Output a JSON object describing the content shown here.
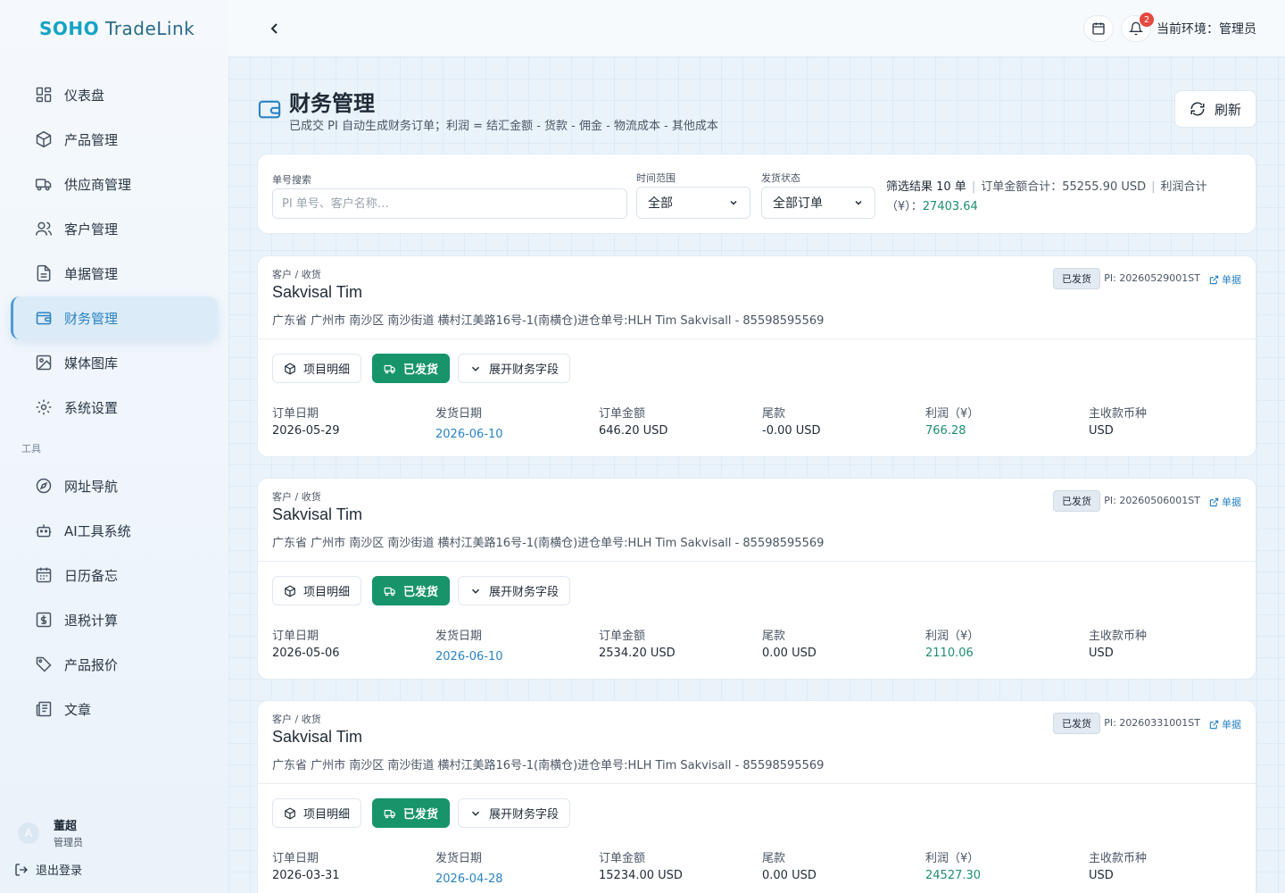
{
  "brand": {
    "part1": "SOHO",
    "part2": "TradeLink"
  },
  "nav": {
    "items": [
      {
        "label": "仪表盘",
        "icon": "dashboard-icon"
      },
      {
        "label": "产品管理",
        "icon": "package-icon"
      },
      {
        "label": "供应商管理",
        "icon": "truck-icon"
      },
      {
        "label": "客户管理",
        "icon": "users-icon"
      },
      {
        "label": "单据管理",
        "icon": "document-icon"
      },
      {
        "label": "财务管理",
        "icon": "wallet-icon",
        "active": true
      },
      {
        "label": "媒体图库",
        "icon": "image-icon"
      },
      {
        "label": "系统设置",
        "icon": "gear-icon"
      }
    ],
    "tools_section": "工具",
    "tools": [
      {
        "label": "网址导航",
        "icon": "compass-icon"
      },
      {
        "label": "AI工具系统",
        "icon": "robot-icon"
      },
      {
        "label": "日历备忘",
        "icon": "calendar-icon"
      },
      {
        "label": "退税计算",
        "icon": "dollar-icon"
      },
      {
        "label": "产品报价",
        "icon": "tag-icon"
      },
      {
        "label": "文章",
        "icon": "article-icon"
      }
    ]
  },
  "user": {
    "avatar": "A",
    "name": "董超",
    "role": "管理员",
    "logout": "退出登录"
  },
  "topbar": {
    "notifications": "2",
    "env": "当前环境：管理员"
  },
  "page": {
    "title": "财务管理",
    "subtitle": "已成交 PI 自动生成财务订单；利润 = 结汇金额 - 货款 - 佣金 - 物流成本 - 其他成本",
    "refresh": "刷新"
  },
  "filter": {
    "search_label": "单号搜索",
    "search_placeholder": "PI 单号、客户名称…",
    "time_label": "时间范围",
    "time_value": "全部",
    "status_label": "发货状态",
    "status_value": "全部订单",
    "result": "筛选结果 10 单",
    "total_amount": "订单金额合计：55255.90 USD",
    "profit_label": "利润合计（¥）：",
    "profit_value": "27403.64"
  },
  "labels": {
    "customer": "客户 / 收货",
    "details_btn": "项目明细",
    "shipped_btn": "已发货",
    "expand_btn": "展开财务字段",
    "doc_link": "单据",
    "order_date": "订单日期",
    "ship_date": "发货日期",
    "amount": "订单金额",
    "balance": "尾款",
    "profit": "利润（¥）",
    "currency": "主收款币种"
  },
  "orders": [
    {
      "name": "Sakvisal Tim",
      "address": "广东省 广州市 南沙区 南沙街道 横村江美路16号-1(南横仓)进仓单号:HLH Tim Sakvisall - 85598595569",
      "status": "已发货",
      "pi": "PI: 20260529001ST",
      "order_date": "2026-05-29",
      "ship_date": "2026-06-10",
      "amount": "646.20 USD",
      "balance": "-0.00 USD",
      "profit": "766.28",
      "currency": "USD"
    },
    {
      "name": "Sakvisal Tim",
      "address": "广东省 广州市 南沙区 南沙街道 横村江美路16号-1(南横仓)进仓单号:HLH Tim Sakvisall - 85598595569",
      "status": "已发货",
      "pi": "PI: 20260506001ST",
      "order_date": "2026-05-06",
      "ship_date": "2026-06-10",
      "amount": "2534.20 USD",
      "balance": "0.00 USD",
      "profit": "2110.06",
      "currency": "USD"
    },
    {
      "name": "Sakvisal Tim",
      "address": "广东省 广州市 南沙区 南沙街道 横村江美路16号-1(南横仓)进仓单号:HLH Tim Sakvisall - 85598595569",
      "status": "已发货",
      "pi": "PI: 20260331001ST",
      "order_date": "2026-03-31",
      "ship_date": "2026-04-28",
      "amount": "15234.00 USD",
      "balance": "0.00 USD",
      "profit": "24527.30",
      "currency": "USD"
    }
  ]
}
